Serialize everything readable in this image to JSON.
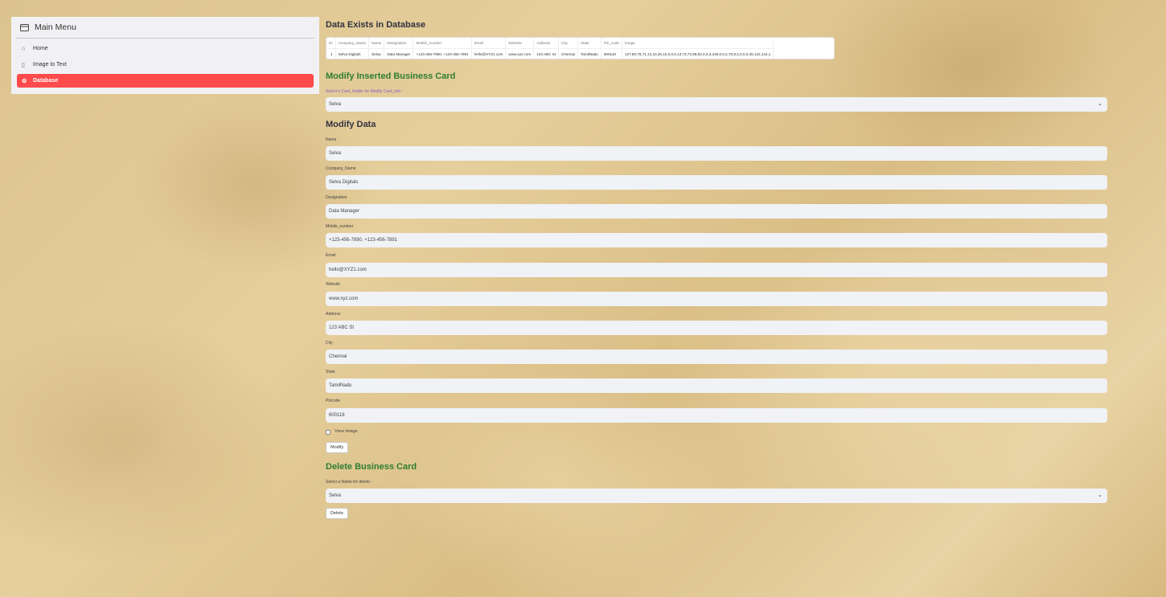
{
  "sidebar": {
    "title": "Main Menu",
    "items": [
      {
        "label": "Home",
        "icon": "house-icon",
        "active": false
      },
      {
        "label": "Image to Text",
        "icon": "file-icon",
        "active": false
      },
      {
        "label": "Database",
        "icon": "gear-icon",
        "active": true
      }
    ]
  },
  "main": {
    "data_exists_title": "Data Exists in Database",
    "table": {
      "columns": [
        "ID",
        "Company_Name",
        "Name",
        "Designation",
        "Mobile_number",
        "Email",
        "Website",
        "Address",
        "City",
        "State",
        "Pin_code",
        "Image"
      ],
      "rows": [
        [
          "1",
          "Selva Digitals",
          "Selva",
          "Data Manager",
          "+123-456-7890, +123-456-7891",
          "hello@XYZ1.com",
          "www.xyz.com",
          "123 ABC St",
          "Chennai",
          "TamilNadu",
          "600118",
          "137,80,78,71,13,10,26,10,0,0,0,13,73,72,68,82,0,0,3,236,0,0,2,70,8,2,0,0,0,45,122,144,1"
        ]
      ]
    },
    "modify_title": "Modify Inserted Business Card",
    "select_label": "Select a Card_holder for Modify Card_info :",
    "select_value": "Selva",
    "modify_data_title": "Modify Data",
    "fields": [
      {
        "label": "Name",
        "value": "Selva"
      },
      {
        "label": "Company_Name",
        "value": "Selva Digitals"
      },
      {
        "label": "Designation",
        "value": "Data Manager"
      },
      {
        "label": "Mobile_number",
        "value": "+123-456-7890, +123-456-7891"
      },
      {
        "label": "Email",
        "value": "hello@XYZ1.com"
      },
      {
        "label": "Website",
        "value": "www.xyz.com"
      },
      {
        "label": "Address",
        "value": "123 ABC St"
      },
      {
        "label": "City",
        "value": "Chennai"
      },
      {
        "label": "State",
        "value": "TamilNadu"
      },
      {
        "label": "Pincode",
        "value": "600118"
      }
    ],
    "view_image_label": "View Image",
    "view_image_checked": false,
    "modify_button": "Modify",
    "delete_title": "Delete Business Card",
    "delete_select_label": "Select a Name for delete :",
    "delete_select_value": "Selva",
    "delete_button": "Delete"
  },
  "colors": {
    "accent": "#ff4b4b",
    "heading_green": "#2e7d32",
    "input_bg": "#f0f2f6"
  }
}
